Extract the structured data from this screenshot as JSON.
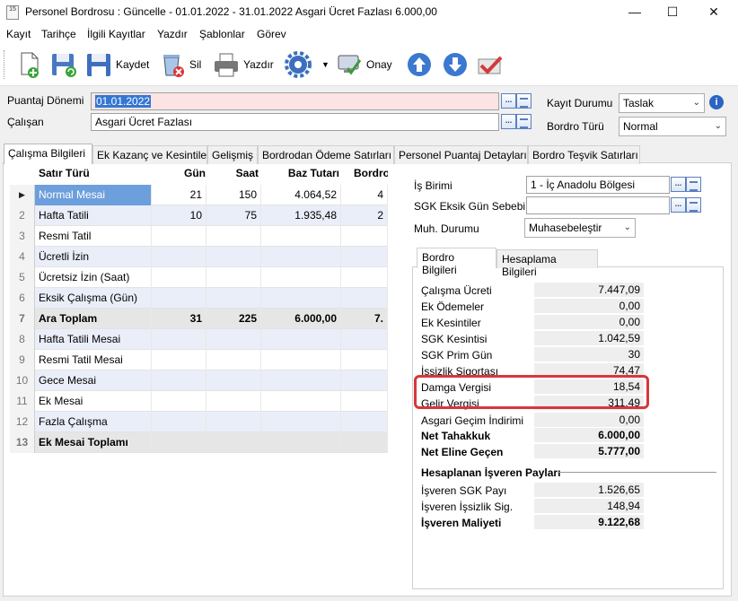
{
  "window": {
    "title": "Personel Bordrosu : Güncelle - 01.01.2022 - 31.01.2022 Asgari Ücret Fazlası 6.000,00",
    "icon_text": "15",
    "controls": [
      "—",
      "☐",
      "✕"
    ]
  },
  "menu": [
    "Kayıt",
    "Tarihçe",
    "İlgili Kayıtlar",
    "Yazdır",
    "Şablonlar",
    "Görev"
  ],
  "toolbar": {
    "save_label": "Kaydet",
    "delete_label": "Sil",
    "print_label": "Yazdır",
    "approve_label": "Onay"
  },
  "form": {
    "puantaj_label": "Puantaj Dönemi",
    "puantaj_value": "01.01.2022",
    "calisan_label": "Çalışan",
    "calisan_value": "Asgari Ücret Fazlası",
    "kayit_durumu_label": "Kayıt Durumu",
    "kayit_durumu_value": "Taslak",
    "bordro_turu_label": "Bordro Türü",
    "bordro_turu_value": "Normal"
  },
  "tabs": [
    "Çalışma Bilgileri",
    "Ek Kazanç ve Kesintiler",
    "Gelişmiş",
    "Bordrodan Ödeme Satırları",
    "Personel Puantaj Detayları",
    "Bordro Teşvik Satırları"
  ],
  "grid": {
    "headers": [
      "Satır Türü",
      "Gün",
      "Saat",
      "Baz Tutarı",
      "Bordro"
    ],
    "rows": [
      {
        "idx": "",
        "name": "Normal Mesai",
        "gun": "21",
        "saat": "150",
        "baz": "4.064,52",
        "bordro": "4"
      },
      {
        "idx": "2",
        "name": "Hafta Tatili",
        "gun": "10",
        "saat": "75",
        "baz": "1.935,48",
        "bordro": "2"
      },
      {
        "idx": "3",
        "name": "Resmi Tatil",
        "gun": "",
        "saat": "",
        "baz": "",
        "bordro": ""
      },
      {
        "idx": "4",
        "name": "Ücretli İzin",
        "gun": "",
        "saat": "",
        "baz": "",
        "bordro": ""
      },
      {
        "idx": "5",
        "name": "Ücretsiz İzin (Saat)",
        "gun": "",
        "saat": "",
        "baz": "",
        "bordro": ""
      },
      {
        "idx": "6",
        "name": "Eksik Çalışma (Gün)",
        "gun": "",
        "saat": "",
        "baz": "",
        "bordro": ""
      },
      {
        "idx": "7",
        "name": "Ara Toplam",
        "gun": "31",
        "saat": "225",
        "baz": "6.000,00",
        "bordro": "7."
      },
      {
        "idx": "8",
        "name": "Hafta Tatili Mesai",
        "gun": "",
        "saat": "",
        "baz": "",
        "bordro": ""
      },
      {
        "idx": "9",
        "name": "Resmi Tatil Mesai",
        "gun": "",
        "saat": "",
        "baz": "",
        "bordro": ""
      },
      {
        "idx": "10",
        "name": "Gece Mesai",
        "gun": "",
        "saat": "",
        "baz": "",
        "bordro": ""
      },
      {
        "idx": "11",
        "name": "Ek Mesai",
        "gun": "",
        "saat": "",
        "baz": "",
        "bordro": ""
      },
      {
        "idx": "12",
        "name": "Fazla Çalışma",
        "gun": "",
        "saat": "",
        "baz": "",
        "bordro": ""
      },
      {
        "idx": "13",
        "name": "Ek Mesai Toplamı",
        "gun": "",
        "saat": "",
        "baz": "",
        "bordro": ""
      }
    ]
  },
  "right": {
    "is_birimi_label": "İş Birimi",
    "is_birimi_value": "1 - İç Anadolu Bölgesi",
    "sgk_eksik_label": "SGK Eksik Gün Sebebi",
    "sgk_eksik_value": "",
    "muh_durumu_label": "Muh. Durumu",
    "muh_durumu_value": "Muhasebeleştir",
    "inner_tabs": [
      "Bordro Bilgileri",
      "Hesaplama Bilgileri"
    ],
    "bordro": [
      {
        "label": "Çalışma Ücreti",
        "value": "7.447,09"
      },
      {
        "label": "Ek Ödemeler",
        "value": "0,00"
      },
      {
        "label": "Ek Kesintiler",
        "value": "0,00"
      },
      {
        "label": "SGK Kesintisi",
        "value": "1.042,59"
      },
      {
        "label": "SGK Prim Gün",
        "value": "30"
      },
      {
        "label": "İşsizlik Sigortası",
        "value": "74,47"
      },
      {
        "label": "Damga Vergisi",
        "value": "18,54"
      },
      {
        "label": "Gelir Vergisi",
        "value": "311,49"
      },
      {
        "label": "Asgari Geçim İndirimi",
        "value": "0,00"
      },
      {
        "label": "Net Tahakkuk",
        "value": "6.000,00"
      },
      {
        "label": "Net Eline Geçen",
        "value": "5.777,00"
      }
    ],
    "isveren_title": "Hesaplanan İşveren Payları",
    "isveren": [
      {
        "label": "İşveren SGK Payı",
        "value": "1.526,65"
      },
      {
        "label": "İşveren İşsizlik Sig.",
        "value": "148,94"
      },
      {
        "label": "İşveren Maliyeti",
        "value": "9.122,68"
      }
    ]
  }
}
